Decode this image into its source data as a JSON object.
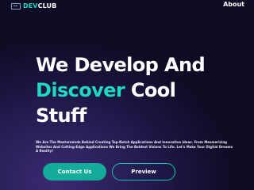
{
  "nav": {
    "logo_dev": "DEV",
    "logo_club": "CLUB",
    "about": "About"
  },
  "hero": {
    "line1": "We Develop And",
    "line2_accent": "Discover",
    "line2_rest": " Cool",
    "line3": "Stuff",
    "subtitle": "We Are The Masterminds Behind Creating Top-Notch Applications And Innovative Ideas. From Mesmerizing Websites And Cutting-Edge Applications We Bring The Boldest Visions To Life. Let's Make Your Digital Dreams A Reality!",
    "primary_button": "Contact Us",
    "secondary_button": "Preview"
  },
  "colors": {
    "accent": "#1fd8c3",
    "button_fill": "#14ab9a",
    "background": "#1a1540"
  }
}
